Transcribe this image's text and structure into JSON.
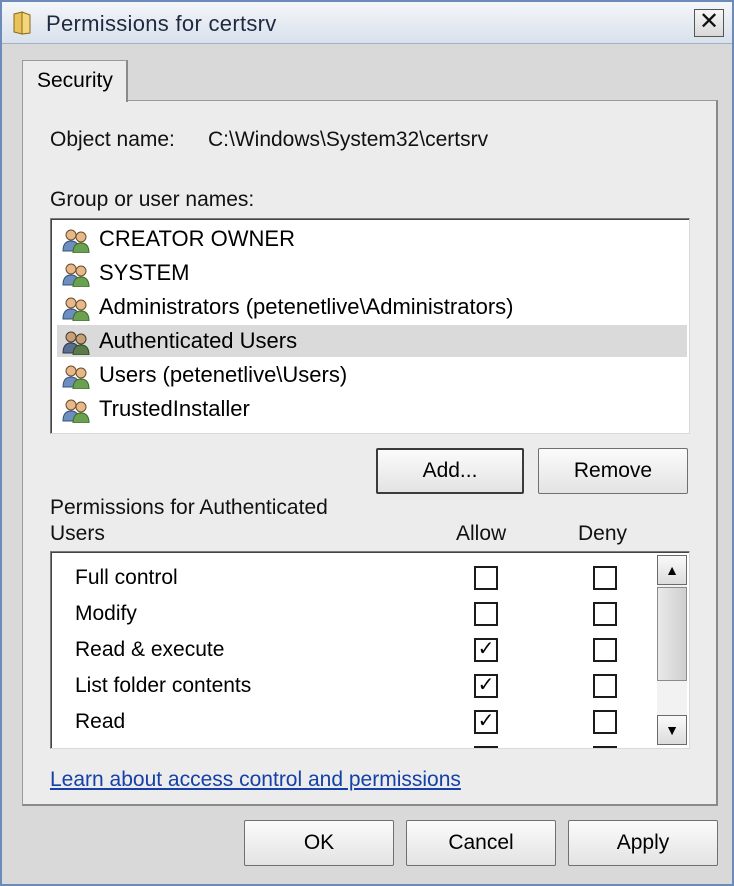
{
  "window": {
    "title": "Permissions for certsrv",
    "close_label": "✕"
  },
  "tabs": [
    {
      "label": "Security"
    }
  ],
  "object": {
    "label": "Object name:",
    "value": "C:\\Windows\\System32\\certsrv"
  },
  "groups": {
    "label": "Group or user names:",
    "items": [
      {
        "label": "CREATOR OWNER",
        "selected": false
      },
      {
        "label": "SYSTEM",
        "selected": false
      },
      {
        "label": "Administrators (petenetlive\\Administrators)",
        "selected": false
      },
      {
        "label": "Authenticated Users",
        "selected": true
      },
      {
        "label": "Users (petenetlive\\Users)",
        "selected": false
      },
      {
        "label": "TrustedInstaller",
        "selected": false
      }
    ],
    "add_label": "Add...",
    "remove_label": "Remove"
  },
  "permissions": {
    "heading_line1": "Permissions for Authenticated",
    "heading_line2": "Users",
    "allow_label": "Allow",
    "deny_label": "Deny",
    "rows": [
      {
        "name": "Full control",
        "allow": false,
        "deny": false
      },
      {
        "name": "Modify",
        "allow": false,
        "deny": false
      },
      {
        "name": "Read & execute",
        "allow": true,
        "deny": false
      },
      {
        "name": "List folder contents",
        "allow": true,
        "deny": false
      },
      {
        "name": "Read",
        "allow": true,
        "deny": false
      }
    ]
  },
  "link": {
    "label": "Learn about access control and permissions"
  },
  "footer": {
    "ok_label": "OK",
    "cancel_label": "Cancel",
    "apply_label": "Apply"
  },
  "colors": {
    "link": "#1540a8",
    "selected_row": "#dadada",
    "window_bg": "#d9d9d9"
  }
}
